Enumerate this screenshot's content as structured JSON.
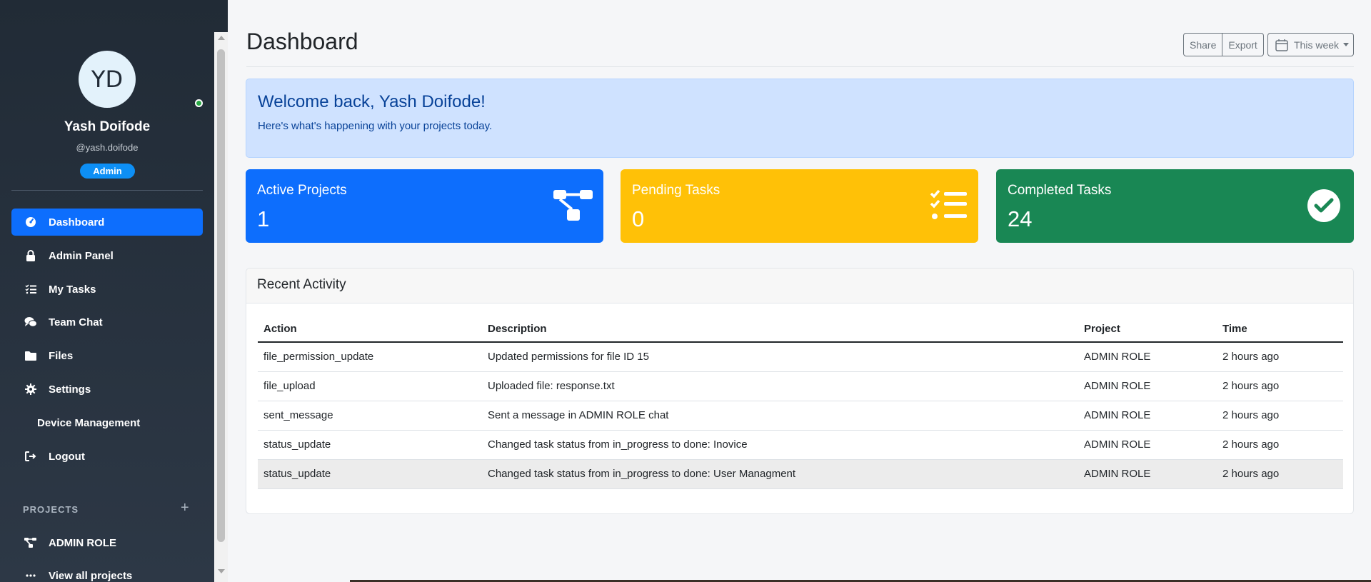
{
  "user": {
    "initials": "YD",
    "name": "Yash Doifode",
    "handle": "@yash.doifode",
    "role": "Admin",
    "status_color": "#28a745"
  },
  "nav": {
    "items": [
      {
        "label": "Dashboard",
        "icon": "gauge-icon",
        "active": true
      },
      {
        "label": "Admin Panel",
        "icon": "lock-icon"
      },
      {
        "label": "My Tasks",
        "icon": "tasks-icon"
      },
      {
        "label": "Team Chat",
        "icon": "chat-icon"
      },
      {
        "label": "Files",
        "icon": "folder-icon"
      },
      {
        "label": "Settings",
        "icon": "gear-icon"
      },
      {
        "label": "Device Management",
        "icon": ""
      },
      {
        "label": "Logout",
        "icon": "logout-icon"
      }
    ]
  },
  "projects": {
    "heading": "PROJECTS",
    "add_symbol": "+",
    "items": [
      {
        "label": "ADMIN ROLE",
        "icon": "project-diagram-icon"
      },
      {
        "label": "View all projects",
        "icon": "ellipsis-icon"
      }
    ]
  },
  "header": {
    "title": "Dashboard",
    "share_label": "Share",
    "export_label": "Export",
    "range_label": "This week"
  },
  "welcome": {
    "title": "Welcome back, Yash Doifode!",
    "subtitle": "Here's what's happening with your projects today."
  },
  "stats": [
    {
      "title": "Active Projects",
      "value": "1",
      "color": "#0d6efd",
      "icon": "project-diagram-icon"
    },
    {
      "title": "Pending Tasks",
      "value": "0",
      "color": "#ffc107",
      "icon": "tasks-icon"
    },
    {
      "title": "Completed Tasks",
      "value": "24",
      "color": "#198754",
      "icon": "check-circle-icon"
    }
  ],
  "activity": {
    "title": "Recent Activity",
    "columns": [
      "Action",
      "Description",
      "Project",
      "Time"
    ],
    "rows": [
      [
        "file_permission_update",
        "Updated permissions for file ID 15",
        "ADMIN ROLE",
        "2 hours ago"
      ],
      [
        "file_upload",
        "Uploaded file: response.txt",
        "ADMIN ROLE",
        "2 hours ago"
      ],
      [
        "sent_message",
        "Sent a message in ADMIN ROLE chat",
        "ADMIN ROLE",
        "2 hours ago"
      ],
      [
        "status_update",
        "Changed task status from in_progress to done: Inovice",
        "ADMIN ROLE",
        "2 hours ago"
      ],
      [
        "status_update",
        "Changed task status from in_progress to done: User Managment",
        "ADMIN ROLE",
        "2 hours ago"
      ]
    ]
  }
}
